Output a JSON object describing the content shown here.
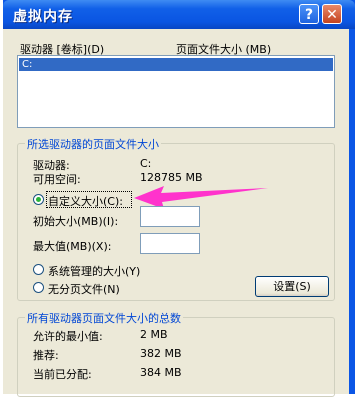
{
  "window": {
    "title": "虚拟内存",
    "help_glyph": "?",
    "close_glyph": "✕"
  },
  "drives_section": {
    "col_drive": "驱动器 [卷标](D)",
    "col_size": "页面文件大小 (MB)",
    "drives": [
      {
        "label": "C:"
      }
    ]
  },
  "selected_drive": {
    "group_title": "所选驱动器的页面文件大小",
    "drive_label": "驱动器:",
    "drive_value": "C:",
    "free_label": "可用空间:",
    "free_value": "128785 MB",
    "custom_label": "自定义大小(C):",
    "initial_label": "初始大小(MB)(I):",
    "initial_value": "",
    "max_label": "最大值(MB)(X):",
    "max_value": "",
    "system_label": "系统管理的大小(Y)",
    "nopage_label": "无分页文件(N)",
    "set_button": "设置(S)",
    "selected_option": "custom"
  },
  "totals": {
    "group_title": "所有驱动器页面文件大小的总数",
    "min_label": "允许的最小值:",
    "min_value": "2 MB",
    "rec_label": "推荐:",
    "rec_value": "382 MB",
    "cur_label": "当前已分配:",
    "cur_value": "384 MB"
  },
  "colors": {
    "title_blue": "#0b56e6",
    "dialog_bg": "#ece9d8",
    "selection": "#316ac5",
    "group_title": "#0046d5",
    "annotation_arrow": "#ff33cc"
  }
}
